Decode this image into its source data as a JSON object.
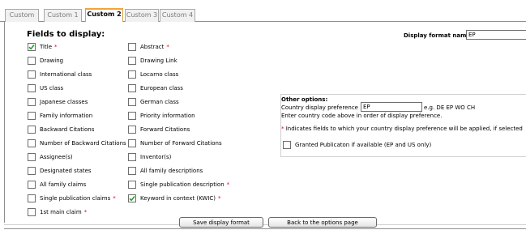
{
  "tabs": [
    {
      "label": "Custom"
    },
    {
      "label": "Custom 1"
    },
    {
      "label": "Custom 2"
    },
    {
      "label": "Custom 3"
    },
    {
      "label": "Custom 4"
    }
  ],
  "active_tab": "Custom 2",
  "fields": {
    "title": "Fields to display:",
    "required_marker": "*",
    "left_column": [
      {
        "label": "Title",
        "checked": true,
        "required": true
      },
      {
        "label": "Drawing",
        "checked": false,
        "required": false
      },
      {
        "label": "International class",
        "checked": false,
        "required": false
      },
      {
        "label": "US class",
        "checked": false,
        "required": false
      },
      {
        "label": "Japanese classes",
        "checked": false,
        "required": false
      },
      {
        "label": "Family information",
        "checked": false,
        "required": false
      },
      {
        "label": "Backward Citations",
        "checked": false,
        "required": false
      },
      {
        "label": "Number of Backward Citations",
        "checked": false,
        "required": false
      },
      {
        "label": "Assignee(s)",
        "checked": false,
        "required": false
      },
      {
        "label": "Designated states",
        "checked": false,
        "required": false
      },
      {
        "label": "All family claims",
        "checked": false,
        "required": false
      },
      {
        "label": "Single publication claims",
        "checked": false,
        "required": true
      },
      {
        "label": "1st main claim",
        "checked": false,
        "required": true
      }
    ],
    "right_column": [
      {
        "label": "Abstract",
        "checked": false,
        "required": true
      },
      {
        "label": "Drawing Link",
        "checked": false,
        "required": false
      },
      {
        "label": "Locarno class",
        "checked": false,
        "required": false
      },
      {
        "label": "European class",
        "checked": false,
        "required": false
      },
      {
        "label": "German class",
        "checked": false,
        "required": false
      },
      {
        "label": "Priority information",
        "checked": false,
        "required": false
      },
      {
        "label": "Forward Citations",
        "checked": false,
        "required": false
      },
      {
        "label": "Number of Forward Citations",
        "checked": false,
        "required": false
      },
      {
        "label": "Inventor(s)",
        "checked": false,
        "required": false
      },
      {
        "label": "All family descriptions",
        "checked": false,
        "required": false
      },
      {
        "label": "Single publication description",
        "checked": false,
        "required": true
      },
      {
        "label": "Keyword in context (KWIC)",
        "checked": true,
        "required": true
      }
    ]
  },
  "display_format": {
    "label": "Display format name",
    "value": "EP"
  },
  "other_options": {
    "title": "Other options:",
    "country_pref_label": "Country display preference",
    "country_pref_value": "EP",
    "country_pref_example": "e.g. DE EP WO CH",
    "country_pref_hint": "Enter country code above in order of display preference.",
    "note": "* Indicates fields to which your country display preference will be applied, if selected",
    "granted_label": "Granted Publicaton if available (EP and US only)",
    "granted_checked": false
  },
  "buttons": {
    "save": "Save display format",
    "back": "Back to the options page"
  },
  "colors": {
    "required": "#e0001b",
    "active_tab_accent": "#f2a43a",
    "checkmark": "#1a9a1a"
  }
}
